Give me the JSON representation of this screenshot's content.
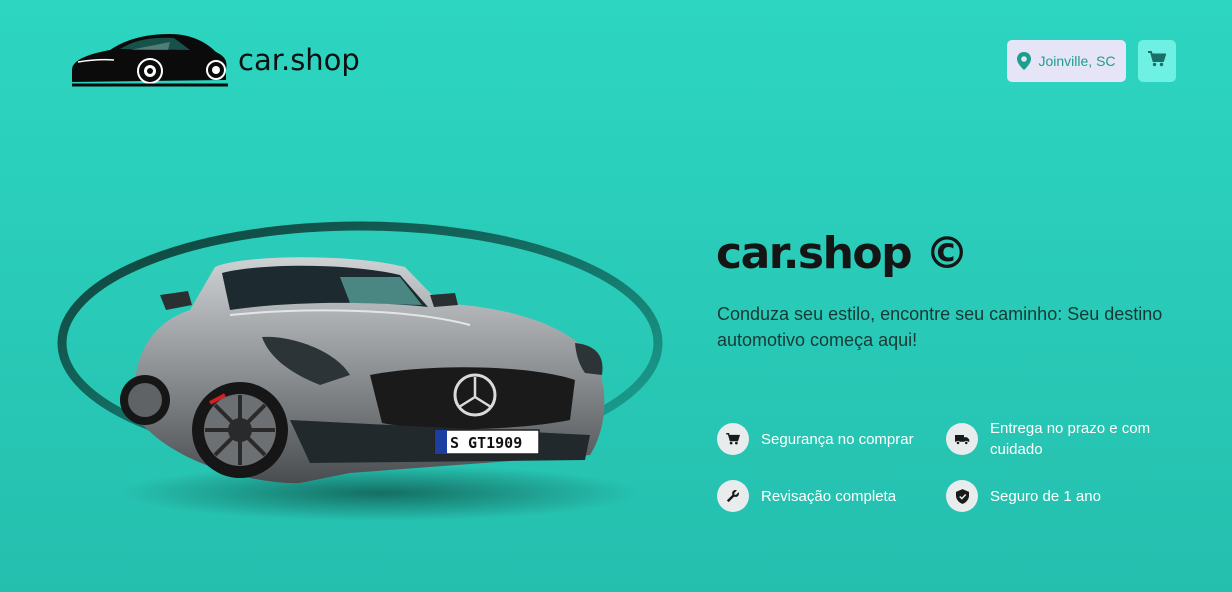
{
  "header": {
    "logo_text": "car.shop",
    "location_label": "Joinville, SC",
    "location_icon": "map-pin-icon",
    "cart_icon": "cart-icon"
  },
  "hero": {
    "title": "car.shop ©",
    "subtitle": "Conduza seu estilo, encontre seu caminho: Seu destino automotivo começa aqui!",
    "car_plate": "S GT1909"
  },
  "features": [
    {
      "label": "Segurança no comprar",
      "icon": "cart-icon"
    },
    {
      "label": "Entrega no prazo e com cuidado",
      "icon": "truck-icon"
    },
    {
      "label": "Revisação completa",
      "icon": "wrench-icon"
    },
    {
      "label": "Seguro de 1 ano",
      "icon": "shield-icon"
    }
  ],
  "colors": {
    "background": "#2dd6c1",
    "location_button_bg": "#e6e4f7",
    "location_text": "#1e9e8f",
    "cart_button_bg": "#6ef0e2",
    "title_text": "#151515"
  }
}
